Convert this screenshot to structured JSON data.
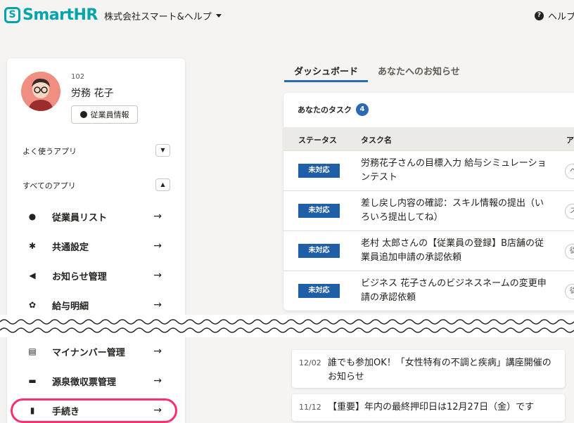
{
  "header": {
    "logo_mark": "S",
    "logo_text": "SmartHR",
    "company": "株式会社スマート&ヘルプ",
    "help_label": "ヘルプ"
  },
  "profile": {
    "employee_number": "102",
    "name": "労務 花子",
    "info_button": "従業員情報"
  },
  "sidebar": {
    "favorite_apps": "よく使うアプリ",
    "all_apps": "すべてのアプリ",
    "items": [
      {
        "label": "従業員リスト",
        "icon": "person-icon"
      },
      {
        "label": "共通設定",
        "icon": "gear-icon"
      },
      {
        "label": "お知らせ管理",
        "icon": "megaphone-icon"
      },
      {
        "label": "給与明細",
        "icon": "payslip-icon"
      },
      {
        "label": "マイナンバー管理",
        "icon": "id-card-icon"
      },
      {
        "label": "源泉徴収票管理",
        "icon": "wallet-icon"
      },
      {
        "label": "手続き",
        "icon": "document-icon"
      }
    ]
  },
  "tabs": [
    {
      "label": "ダッシュボード",
      "active": true
    },
    {
      "label": "あなたへのお知らせ",
      "active": false
    }
  ],
  "tasks": {
    "title": "あなたのタスク",
    "count": "4",
    "columns": [
      "ステータス",
      "タスク名",
      "ア"
    ],
    "rows": [
      {
        "status": "未対応",
        "name": "労務花子さんの目標入力 給与シミュレーションテスト",
        "action": "ペ"
      },
      {
        "status": "未対応",
        "name": "差し戻し内容の確認：スキル情報の提出（いろいろ提出してね）",
        "action": "ス"
      },
      {
        "status": "未対応",
        "name": "老村 太郎さんの【従業員の登録】B店舗の従業員追加申請の承認依頼",
        "action": "従"
      },
      {
        "status": "未対応",
        "name": "ビジネス 花子さんのビジネスネームの変更申請の承認依頼",
        "action": "従"
      }
    ]
  },
  "news": [
    {
      "date": "12/02",
      "text": "誰でも参加OK！「女性特有の不調と疾病」講座開催のお知らせ"
    },
    {
      "date": "11/12",
      "text": "【重要】年内の最終押印日は12月27日（金）です"
    }
  ],
  "colors": {
    "brand": "#00a5ab",
    "accent_blue": "#1f5fa8",
    "highlight": "#ff2e6b"
  }
}
